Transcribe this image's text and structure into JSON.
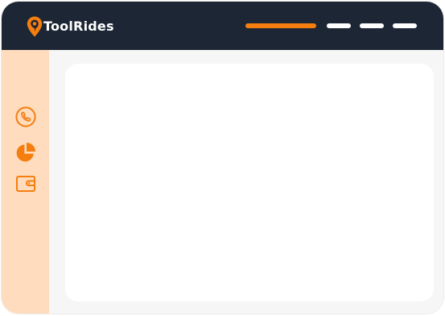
{
  "app": {
    "brand_name": "ToolRides",
    "logo_icon": "location-pin-icon"
  },
  "colors": {
    "topbar_bg": "#1d2634",
    "accent": "#f57e0f",
    "sidebar_bg": "#ffdcbd",
    "content_bg": "#ffffff",
    "page_bg": "#f6f6f6"
  },
  "nav": {
    "items": [
      {
        "id": "nav-item-1",
        "active": true
      },
      {
        "id": "nav-item-2",
        "active": false
      },
      {
        "id": "nav-item-3",
        "active": false
      },
      {
        "id": "nav-item-4",
        "active": false
      }
    ]
  },
  "sidebar": {
    "items": [
      {
        "icon": "phone-icon"
      },
      {
        "icon": "pie-chart-icon"
      },
      {
        "icon": "wallet-icon"
      }
    ]
  }
}
